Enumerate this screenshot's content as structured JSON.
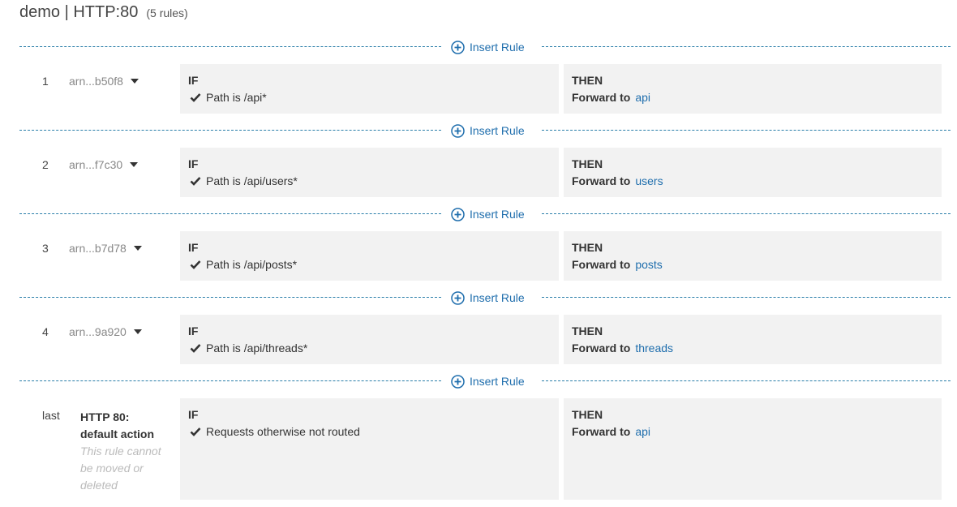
{
  "header": {
    "title": "demo | HTTP:80",
    "rule_count": "(5 rules)"
  },
  "insert_label": "Insert Rule",
  "if_label": "IF",
  "then_label": "THEN",
  "forward_label": "Forward to",
  "rules": [
    {
      "number": "1",
      "arn": "arn...b50f8",
      "condition": "Path is /api*",
      "target": "api"
    },
    {
      "number": "2",
      "arn": "arn...f7c30",
      "condition": "Path is /api/users*",
      "target": "users"
    },
    {
      "number": "3",
      "arn": "arn...b7d78",
      "condition": "Path is /api/posts*",
      "target": "posts"
    },
    {
      "number": "4",
      "arn": "arn...9a920",
      "condition": "Path is /api/threads*",
      "target": "threads"
    }
  ],
  "default_rule": {
    "number": "last",
    "title_line1": "HTTP 80:",
    "title_line2": "default action",
    "note": "This rule cannot be moved or deleted",
    "condition": "Requests otherwise not routed",
    "target": "api"
  },
  "colors": {
    "accent": "#1f6ead",
    "divider": "#2a7ea9",
    "panel": "#f2f2f2"
  },
  "icons": {
    "insert": "plus-circle-icon",
    "condition": "checkmark-icon",
    "menu": "caret-down-icon"
  }
}
